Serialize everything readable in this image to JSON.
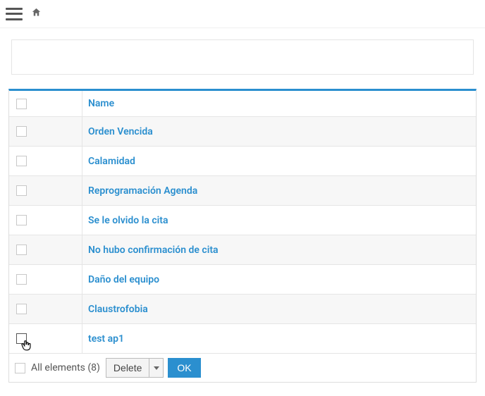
{
  "table": {
    "header_name": "Name",
    "rows": [
      {
        "name": "Orden Vencida"
      },
      {
        "name": "Calamidad"
      },
      {
        "name": "Reprogramación Agenda"
      },
      {
        "name": "Se le olvido la cita"
      },
      {
        "name": "No hubo confirmación de cita"
      },
      {
        "name": "Daño del equipo"
      },
      {
        "name": "Claustrofobia"
      },
      {
        "name": "test ap1"
      }
    ]
  },
  "footer": {
    "all_label": "All elements (8)",
    "delete_label": "Delete",
    "ok_label": "OK"
  }
}
